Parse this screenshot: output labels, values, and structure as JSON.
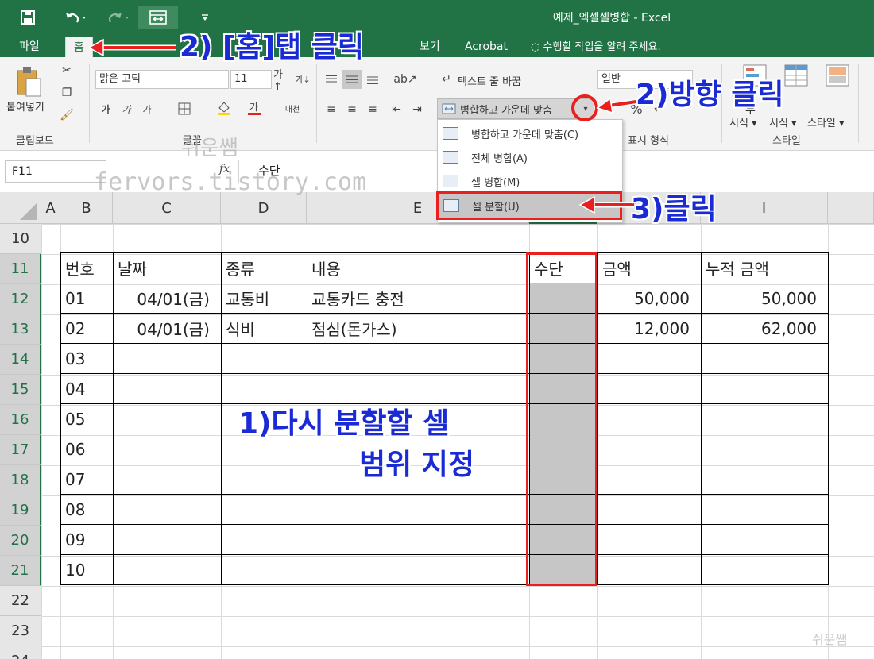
{
  "window": {
    "title": "예제_엑셀셀병합 - Excel"
  },
  "colors": {
    "accent": "#217346",
    "annotation": "#1a2bd6",
    "highlight": "#e8211f"
  },
  "quick_access": {
    "icons": [
      "save-icon",
      "undo-icon",
      "redo-icon",
      "merge-icon",
      "customize-icon"
    ]
  },
  "tabs": [
    {
      "label": "파일"
    },
    {
      "label": "홈",
      "active": true
    },
    {
      "label": "보기"
    },
    {
      "label": "Acrobat"
    }
  ],
  "tell_me": "수행할 작업을 알려 주세요.",
  "ribbon": {
    "clipboard": {
      "paste_label": "붙여넣기",
      "group_label": "클립보드"
    },
    "font": {
      "font_name": "맑은 고딕",
      "font_size": "11",
      "group_label": "글꼴"
    },
    "alignment": {
      "wrap_text": "텍스트 줄 바꿈",
      "merge_center": "병합하고 가운데 맞춤"
    },
    "number": {
      "format": "일반",
      "group_label": "표시 형식"
    },
    "styles": {
      "btn1": "서식",
      "btn2": "서식",
      "btn3": "스타일",
      "group_label": "스타일",
      "partial": "부"
    }
  },
  "merge_menu": [
    {
      "label": "병합하고 가운데 맞춤(C)"
    },
    {
      "label": "전체 병합(A)"
    },
    {
      "label": "셀 병합(M)"
    },
    {
      "label": "셀 분할(U)",
      "highlighted": true
    }
  ],
  "formula_bar": {
    "name_box": "F11",
    "fx": "fx",
    "value": "수단"
  },
  "columns": [
    "A",
    "B",
    "C",
    "D",
    "E",
    "",
    "I"
  ],
  "rows": [
    "10",
    "11",
    "12",
    "13",
    "14",
    "15",
    "16",
    "17",
    "18",
    "19",
    "20",
    "21",
    "22",
    "23",
    "24"
  ],
  "table": {
    "headers": [
      "번호",
      "날짜",
      "종류",
      "내용",
      "수단",
      "금액",
      "누적 금액"
    ],
    "rows": [
      [
        "01",
        "04/01(금)",
        "교통비",
        "교통카드 충전",
        "",
        "50,000",
        "50,000"
      ],
      [
        "02",
        "04/01(금)",
        "식비",
        "점심(돈가스)",
        "",
        "12,000",
        "62,000"
      ],
      [
        "03",
        "",
        "",
        "",
        "",
        "",
        ""
      ],
      [
        "04",
        "",
        "",
        "",
        "",
        "",
        ""
      ],
      [
        "05",
        "",
        "",
        "",
        "",
        "",
        ""
      ],
      [
        "06",
        "",
        "",
        "",
        "",
        "",
        ""
      ],
      [
        "07",
        "",
        "",
        "",
        "",
        "",
        ""
      ],
      [
        "08",
        "",
        "",
        "",
        "",
        "",
        ""
      ],
      [
        "09",
        "",
        "",
        "",
        "",
        "",
        ""
      ],
      [
        "10",
        "",
        "",
        "",
        "",
        "",
        ""
      ]
    ]
  },
  "annotations": {
    "step1_line1": "1)다시 분할할 셀",
    "step1_line2": "범위 지정",
    "step2a": "2) [홈]탭 클릭",
    "step2b": "2)방향 클릭",
    "step3": "3)클릭"
  },
  "watermark": {
    "name": "쉬운쌤",
    "url": "fervors.tistory.com"
  }
}
